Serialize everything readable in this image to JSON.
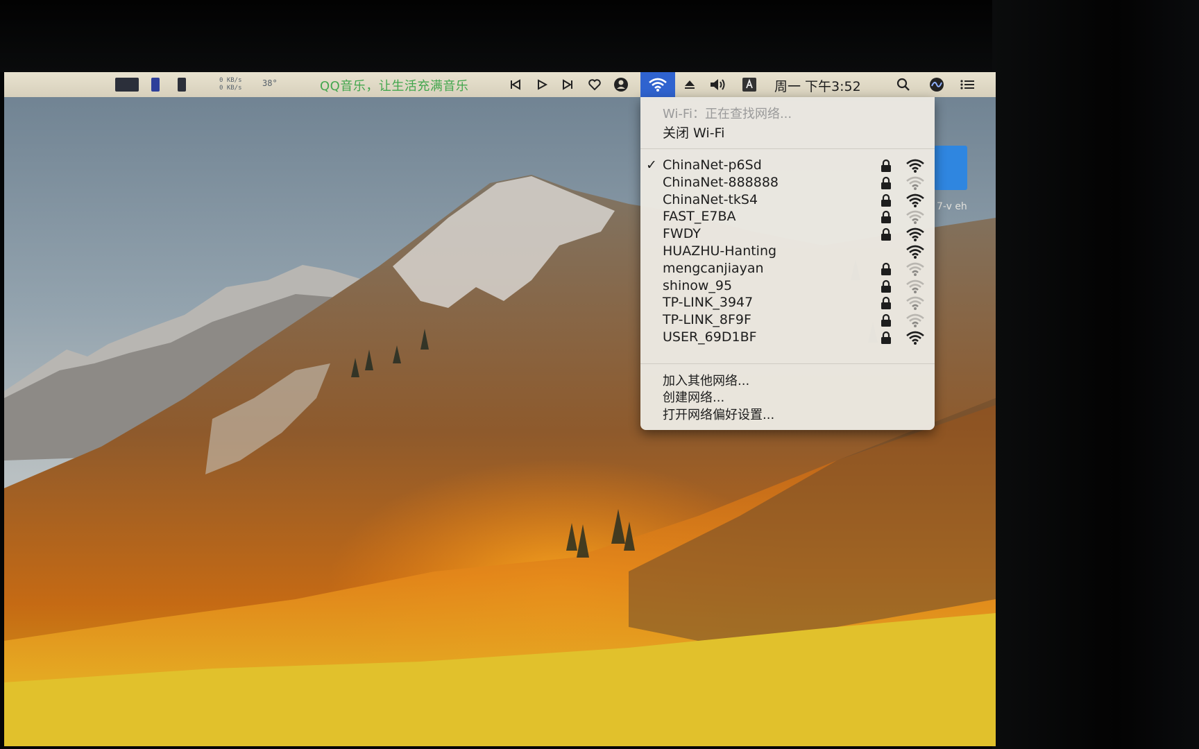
{
  "menubar": {
    "qq_music_ticker": "QQ音乐，让生活充满音乐",
    "clock": "周一 下午3:52",
    "small_stats": [
      "0 KB/s",
      "0 KB/s",
      "38°"
    ]
  },
  "wifi_menu": {
    "status": "Wi-Fi：正在查找网络...",
    "toggle_label": "关闭 Wi-Fi",
    "networks": [
      {
        "name": "ChinaNet-p6Sd",
        "connected": true,
        "locked": true,
        "signal": "strong"
      },
      {
        "name": "ChinaNet-888888",
        "connected": false,
        "locked": true,
        "signal": "weak"
      },
      {
        "name": "ChinaNet-tkS4",
        "connected": false,
        "locked": true,
        "signal": "strong"
      },
      {
        "name": "FAST_E7BA",
        "connected": false,
        "locked": true,
        "signal": "weak"
      },
      {
        "name": "FWDY",
        "connected": false,
        "locked": true,
        "signal": "strong"
      },
      {
        "name": "HUAZHU-Hanting",
        "connected": false,
        "locked": false,
        "signal": "strong"
      },
      {
        "name": "mengcanjiayan",
        "connected": false,
        "locked": true,
        "signal": "weak"
      },
      {
        "name": "shinow_95",
        "connected": false,
        "locked": true,
        "signal": "weak"
      },
      {
        "name": "TP-LINK_3947",
        "connected": false,
        "locked": true,
        "signal": "weak"
      },
      {
        "name": "TP-LINK_8F9F",
        "connected": false,
        "locked": true,
        "signal": "weak"
      },
      {
        "name": "USER_69D1BF",
        "connected": false,
        "locked": true,
        "signal": "strong"
      }
    ],
    "actions": [
      "加入其他网络...",
      "创建网络...",
      "打开网络偏好设置..."
    ],
    "check_glyph": "✓"
  },
  "desktop": {
    "partial_icon_label": "7-v eh"
  },
  "icons": {
    "prev": "skip-back-icon",
    "play": "play-icon",
    "next": "skip-forward-icon",
    "favorite": "heart-icon",
    "user": "user-circle-icon",
    "wifi": "wifi-icon",
    "eject": "eject-icon",
    "volume": "volume-icon",
    "input": "input-source-icon",
    "search": "search-icon",
    "siri": "siri-icon",
    "notifications": "notification-list-icon"
  },
  "colors": {
    "menubar": "#ddd6c3",
    "wifi_highlight": "#2f63cf",
    "qq_green": "#42a64d",
    "menu_bg": "#ece9e2"
  }
}
